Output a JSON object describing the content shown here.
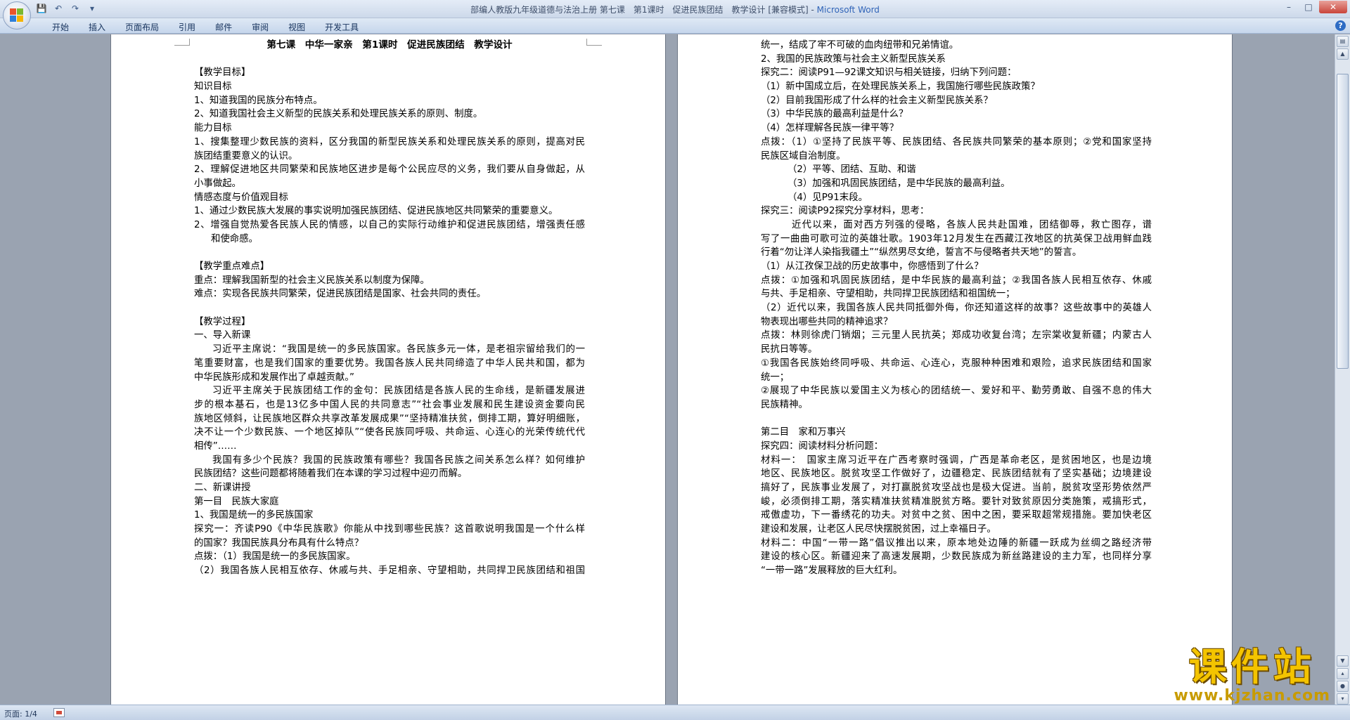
{
  "window": {
    "title_doc": "部编人教版九年级道德与法治上册 第七课　第1课时　促进民族团结　教学设计 [兼容模式] - ",
    "title_app": "Microsoft Word",
    "controls": {
      "minimize": "–",
      "maximize": "□",
      "close": "✕"
    }
  },
  "qat": {
    "save_icon": "💾",
    "undo_icon": "↶",
    "redo_icon": "↷",
    "customize_icon": "▾"
  },
  "ribbon": {
    "tabs": [
      "开始",
      "插入",
      "页面布局",
      "引用",
      "邮件",
      "审阅",
      "视图",
      "开发工具"
    ],
    "help": "?"
  },
  "document": {
    "left_page": [
      "第七课　中华一家亲　第1课时　促进民族团结　教学设计",
      "",
      "【教学目标】",
      "知识目标",
      "1、知道我国的民族分布特点。",
      "2、知道我国社会主义新型的民族关系和处理民族关系的原则、制度。",
      "能力目标",
      "1、搜集整理少数民族的资料，区分我国的新型民族关系和处理民族关系的原则，提高对民",
      "族团结重要意义的认识。",
      "2、理解促进地区共同繁荣和民族地区进步是每个公民应尽的义务，我们要从自身做起，从",
      "小事做起。",
      "情感态度与价值观目标",
      "1、通过少数民族大发展的事实说明加强民族团结、促进民族地区共同繁荣的重要意义。",
      "2、增强自觉热爱各民族人民的情感，以自己的实际行动维护和促进民族团结，增强责任感",
      "和使命感。",
      "",
      "【教学重点难点】",
      "重点：理解我国新型的社会主义民族关系以制度为保障。",
      "难点：实现各民族共同繁荣，促进民族团结是国家、社会共同的责任。",
      "",
      "【教学过程】",
      "一、导入新课",
      "习近平主席说：“我国是统一的多民族国家。各民族多元一体，是老祖宗留给我们的一",
      "笔重要财富，也是我们国家的重要优势。我国各族人民共同缔造了中华人民共和国，都为",
      "中华民族形成和发展作出了卓越贡献。”",
      "习近平主席关于民族团结工作的金句：民族团结是各族人民的生命线，是新疆发展进",
      "步的根本基石，也是13亿多中国人民的共同意志”“社会事业发展和民生建设资金要向民",
      "族地区倾斜，让民族地区群众共享改革发展成果”“坚持精准扶贫，倒排工期，算好明细账，",
      "决不让一个少数民族、一个地区掉队”“使各民族同呼吸、共命运、心连心的光荣传统代代",
      "相传”……",
      "我国有多少个民族？我国的民族政策有哪些？我国各民族之间关系怎么样？如何维护",
      "民族团结？这些问题都将随着我们在本课的学习过程中迎刃而解。",
      "二、新课讲授",
      "第一目　民族大家庭",
      "1、我国是统一的多民族国家",
      "探究一：齐读P90《中华民族歌》你能从中找到哪些民族？这首歌说明我国是一个什么样",
      "的国家？我国民族具分布具有什么特点？",
      "点拨：（1）我国是统一的多民族国家。",
      "（2）我国各族人民相互依存、休戚与共、手足相亲、守望相助，共同捍卫民族团结和祖国"
    ],
    "right_page": [
      "统一，结成了牢不可破的血肉纽带和兄弟情谊。",
      "2、我国的民族政策与社会主义新型民族关系",
      "探究二：阅读P91—92课文知识与相关链接，归纳下列问题：",
      "（1）新中国成立后，在处理民族关系上，我国施行哪些民族政策？",
      "（2）目前我国形成了什么样的社会主义新型民族关系？",
      "（3）中华民族的最高利益是什么？",
      "（4）怎样理解各民族一律平等？",
      "点拨：（1）①坚持了民族平等、民族团结、各民族共同繁荣的基本原则；②党和国家坚持",
      "民族区域自治制度。",
      "（2）平等、团结、互助、和谐",
      "（3）加强和巩固民族团结，是中华民族的最高利益。",
      "（4）见P91末段。",
      "探究三：阅读P92探究分享材料，思考：",
      "近代以来，面对西方列强的侵略，各族人民共赴国难，团结御辱，救亡图存，谱",
      "写了一曲曲可歌可泣的英雄壮歌。1903年12月发生在西藏江孜地区的抗英保卫战用鲜血践",
      "行着“勿让洋人染指我疆土”“纵然男尽女绝，誓言不与侵略者共天地”的誓言。",
      "（1）从江孜保卫战的历史故事中，你感悟到了什么？",
      "点拨：①加强和巩固民族团结，是中华民族的最高利益；②我国各族人民相互依存、休戚",
      "与共、手足相亲、守望相助，共同捍卫民族团结和祖国统一；",
      "（2）近代以来，我国各族人民共同抵御外侮，你还知道这样的故事？这些故事中的英雄人",
      "物表现出哪些共同的精神追求？",
      "点拨：林则徐虎门销烟；三元里人民抗英；郑成功收复台湾；左宗棠收复新疆；内蒙古人",
      "民抗日等等。",
      "①我国各民族始终同呼吸、共命运、心连心，克服种种困难和艰险，追求民族团结和国家",
      "统一；",
      "②展现了中华民族以爱国主义为核心的团结统一、爱好和平、勤劳勇敢、自强不息的伟大",
      "民族精神。",
      "",
      "第二目　家和万事兴",
      "探究四：阅读材料分析问题：",
      "材料一：　国家主席习近平在广西考察时强调，广西是革命老区，是贫困地区，也是边境",
      "地区、民族地区。脱贫攻坚工作做好了，边疆稳定、民族团结就有了坚实基础；边境建设",
      "搞好了，民族事业发展了，对打赢脱贫攻坚战也是极大促进。当前，脱贫攻坚形势依然严",
      "峻，必须倒排工期，落实精准扶贫精准脱贫方略。要针对致贫原因分类施策，戒搞形式，",
      "戒傲虚功，下一番绣花的功夫。对贫中之贫、困中之困，要采取超常规措施。要加快老区",
      "建设和发展，让老区人民尽快摆脱贫困，过上幸福日子。",
      "材料二：中国“一带一路”倡议推出以来，原本地处边陲的新疆一跃成为丝绸之路经济带",
      "建设的核心区。新疆迎来了高速发展期，少数民族成为新丝路建设的主力军，也同样分享",
      "“一带一路”发展释放的巨大红利。"
    ]
  },
  "status_bar": {
    "page_info": "页面: 1/4"
  },
  "watermark": {
    "title": "课件站",
    "url": "www.kjzhan.com"
  },
  "colors": {
    "app_title": "#3064b8",
    "watermark": "#f4c400"
  }
}
